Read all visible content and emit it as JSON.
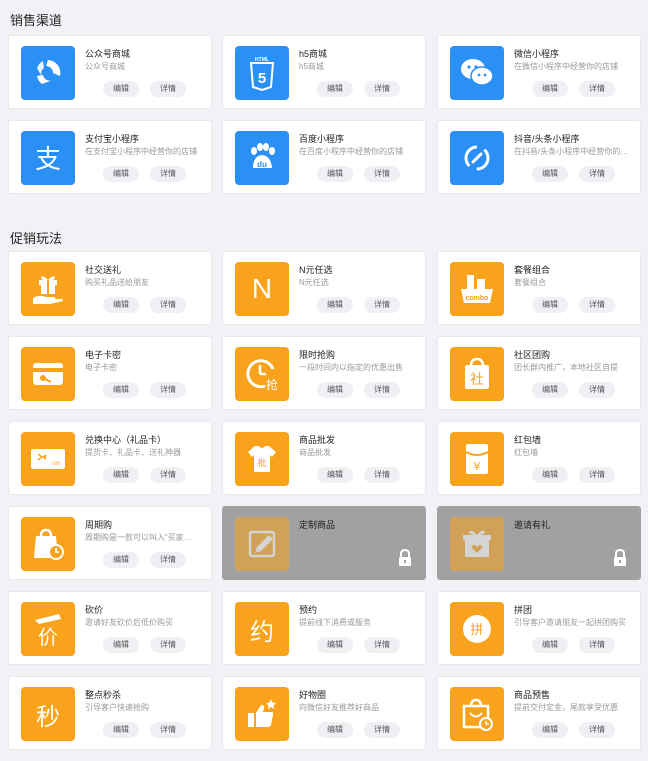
{
  "sections": [
    {
      "title": "销售渠道"
    },
    {
      "title": "促销玩法"
    }
  ],
  "buttons": {
    "edit": "编辑",
    "detail": "详情"
  },
  "sales_channels": [
    {
      "name": "公众号商城",
      "desc": "公众号商城",
      "icon": "wechat-official-icon",
      "color": "#2b90f5"
    },
    {
      "name": "h5商城",
      "desc": "h5商城",
      "icon": "html5-icon",
      "color": "#2b90f5"
    },
    {
      "name": "微信小程序",
      "desc": "在微信小程序中经营你的店铺",
      "icon": "wechat-chat-icon",
      "color": "#2b90f5"
    },
    {
      "name": "支付宝小程序",
      "desc": "在支付宝小程序中经营你的店铺",
      "icon": "alipay-icon",
      "color": "#2b90f5"
    },
    {
      "name": "百度小程序",
      "desc": "在百度小程序中经营你的店铺",
      "icon": "baidu-paw-icon",
      "color": "#2b90f5"
    },
    {
      "name": "抖音/头条小程序",
      "desc": "在抖音/头条小程序中经营你的店铺",
      "icon": "douyin-link-icon",
      "color": "#2b90f5"
    }
  ],
  "promotions": [
    {
      "name": "社交送礼",
      "desc": "购买礼品送给朋友",
      "icon": "gift-hand-icon",
      "locked": false
    },
    {
      "name": "N元任选",
      "desc": "N元任选",
      "icon": "letter-n-icon",
      "glyph": "N",
      "locked": false
    },
    {
      "name": "套餐组合",
      "desc": "套餐组合",
      "icon": "combo-basket-icon",
      "glyph": "combo",
      "locked": false
    },
    {
      "name": "电子卡密",
      "desc": "电子卡密",
      "icon": "card-key-icon",
      "locked": false
    },
    {
      "name": "限时抢购",
      "desc": "一段时间内以指定的优惠出售",
      "icon": "flash-sale-clock-icon",
      "glyph": "抢",
      "locked": false
    },
    {
      "name": "社区团购",
      "desc": "团长群内推广，本地社区自提",
      "icon": "community-bag-icon",
      "glyph": "社",
      "locked": false
    },
    {
      "name": "兑换中心（礼品卡）",
      "desc": "提货卡、礼品卡、送礼神器",
      "icon": "gift-card-icon",
      "glyph": "Gift",
      "locked": false
    },
    {
      "name": "商品批发",
      "desc": "商品批发",
      "icon": "wholesale-shirt-icon",
      "glyph": "批",
      "locked": false
    },
    {
      "name": "红包墙",
      "desc": "红包墙",
      "icon": "red-packet-icon",
      "glyph": "¥",
      "locked": false
    },
    {
      "name": "周期购",
      "desc": "周期购是一款可以叫入“买家…",
      "icon": "subscription-bag-icon",
      "locked": false
    },
    {
      "name": "定制商品",
      "desc": "",
      "icon": "custom-pencil-icon",
      "locked": true
    },
    {
      "name": "邀请有礼",
      "desc": "",
      "icon": "invite-gift-icon",
      "locked": true
    },
    {
      "name": "砍价",
      "desc": "邀请好友砍价后低价购买",
      "icon": "bargain-icon",
      "glyph": "价",
      "locked": false
    },
    {
      "name": "预约",
      "desc": "提前线下消费或服务",
      "icon": "reservation-icon",
      "glyph": "约",
      "locked": false
    },
    {
      "name": "拼团",
      "desc": "引导客户邀请朋友一起拼团购买",
      "icon": "group-buy-icon",
      "glyph": "拼",
      "locked": false
    },
    {
      "name": "整点秒杀",
      "desc": "引导客户快速抢购",
      "icon": "seckill-icon",
      "glyph": "秒",
      "locked": false
    },
    {
      "name": "好物圈",
      "desc": "向微信好友推荐好商品",
      "icon": "thumbs-up-star-icon",
      "locked": false
    },
    {
      "name": "商品预售",
      "desc": "提前交付定金，尾款享受优惠",
      "icon": "presale-bag-icon",
      "locked": false
    }
  ],
  "colors": {
    "blue": "#2b90f5",
    "orange": "#f9a21b",
    "locked_bg": "#a1a1a1"
  }
}
